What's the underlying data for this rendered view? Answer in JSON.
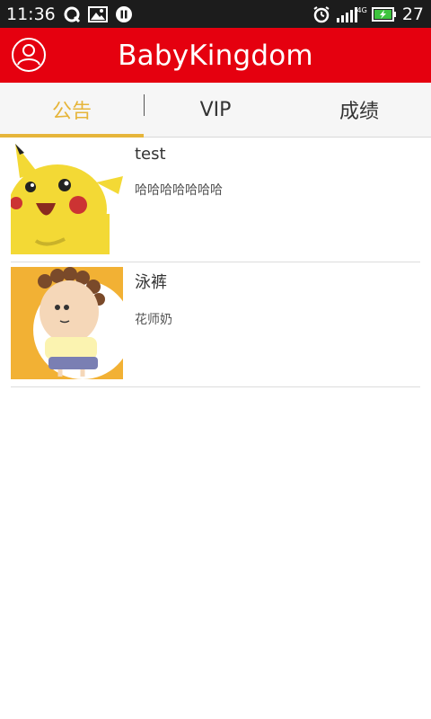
{
  "status_bar": {
    "time": "11:36",
    "battery": "27",
    "left_icons": [
      "q-app-icon",
      "image-icon",
      "pause-icon"
    ],
    "right_icons": [
      "alarm-icon",
      "signal-icon",
      "battery-icon"
    ],
    "network_label": "4G"
  },
  "header": {
    "title": "BabyKingdom",
    "profile_icon": "user-icon",
    "bg_color": "#e5000f"
  },
  "tabs": [
    {
      "label": "公告",
      "active": true
    },
    {
      "label": "VIP",
      "active": false
    },
    {
      "label": "成绩",
      "active": false
    }
  ],
  "accent_color": "#e6b53a",
  "list": [
    {
      "title": "test",
      "subtitle": "哈哈哈哈哈哈哈",
      "image": "pikachu-thumbnail"
    },
    {
      "title": "泳裤",
      "subtitle": "花师奶",
      "image": "cartoon-lady-thumbnail"
    }
  ]
}
